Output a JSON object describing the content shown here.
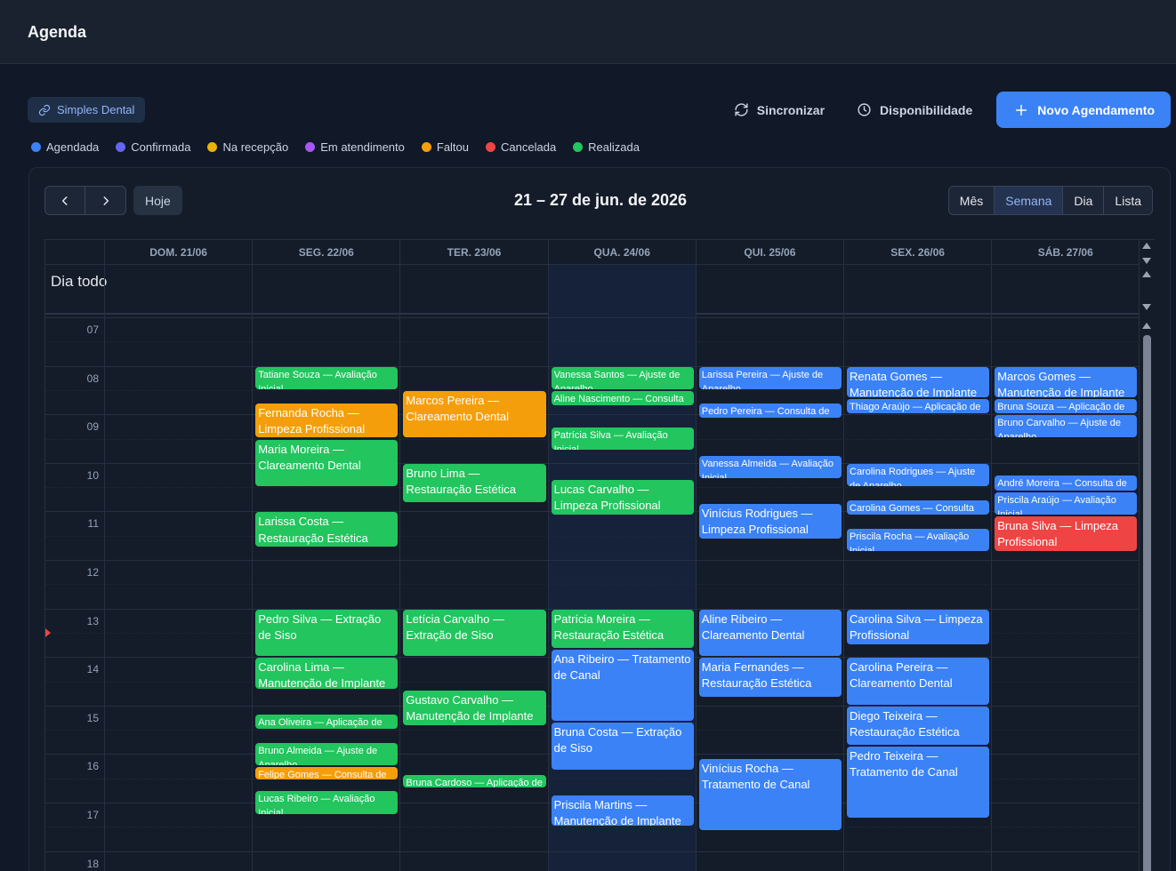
{
  "header": {
    "title": "Agenda"
  },
  "integration_chip": {
    "label": "Simples Dental",
    "icon": "link-icon"
  },
  "actions": {
    "sync_label": "Sincronizar",
    "availability_label": "Disponibilidade",
    "new_label": "Novo Agendamento"
  },
  "legend": [
    {
      "label": "Agendada",
      "color": "#3b82f6"
    },
    {
      "label": "Confirmada",
      "color": "#6366f1"
    },
    {
      "label": "Na recepção",
      "color": "#eab308"
    },
    {
      "label": "Em atendimento",
      "color": "#a855f7"
    },
    {
      "label": "Faltou",
      "color": "#f59e0b"
    },
    {
      "label": "Cancelada",
      "color": "#ef4444"
    },
    {
      "label": "Realizada",
      "color": "#22c55e"
    }
  ],
  "toolbar": {
    "today_label": "Hoje",
    "range_title": "21 – 27 de jun. de 2026",
    "views": [
      "Mês",
      "Semana",
      "Dia",
      "Lista"
    ],
    "active_view": "Semana"
  },
  "days": [
    "DOM. 21/06",
    "SEG. 22/06",
    "TER. 23/06",
    "QUA. 24/06",
    "QUI. 25/06",
    "SEX. 26/06",
    "SÁB. 27/06"
  ],
  "today_index": 3,
  "allday_label": "Dia todo",
  "hours": [
    "07",
    "08",
    "09",
    "10",
    "11",
    "12",
    "13",
    "14",
    "15",
    "16",
    "17",
    "18"
  ],
  "now_time": "13:30",
  "status_colors": {
    "realizada": "#22c55e",
    "faltou": "#f59e0b",
    "agendada": "#3b82f6",
    "cancelada": "#ef4444"
  },
  "events": [
    {
      "day": 1,
      "start": "08:00",
      "end": "08:30",
      "title": "Tatiane Souza — Avaliação Inicial",
      "status": "realizada",
      "size": "small"
    },
    {
      "day": 1,
      "start": "08:45",
      "end": "09:30",
      "title": "Fernanda Rocha — Limpeza Profissional",
      "status": "faltou",
      "size": "big"
    },
    {
      "day": 1,
      "start": "09:30",
      "end": "10:30",
      "title": "Maria Moreira — Clareamento Dental",
      "status": "realizada",
      "size": "big"
    },
    {
      "day": 1,
      "start": "11:00",
      "end": "11:45",
      "title": "Larissa Costa — Restauração Estética",
      "status": "realizada",
      "size": "big"
    },
    {
      "day": 1,
      "start": "13:00",
      "end": "14:00",
      "title": "Pedro Silva — Extração de Siso",
      "status": "realizada",
      "size": "big"
    },
    {
      "day": 1,
      "start": "14:00",
      "end": "14:40",
      "title": "Carolina Lima — Manutenção de Implante",
      "status": "realizada",
      "size": "big"
    },
    {
      "day": 1,
      "start": "15:10",
      "end": "15:30",
      "title": "Ana Oliveira — Aplicação de Flúor",
      "status": "realizada",
      "size": "small"
    },
    {
      "day": 1,
      "start": "15:45",
      "end": "16:15",
      "title": "Bruno Almeida — Ajuste de Aparelho",
      "status": "realizada",
      "size": "small"
    },
    {
      "day": 1,
      "start": "16:15",
      "end": "16:30",
      "title": "Felipe Gomes — Consulta de Rotina",
      "status": "faltou",
      "size": "small"
    },
    {
      "day": 1,
      "start": "16:45",
      "end": "17:15",
      "title": "Lucas Ribeiro — Avaliação Inicial",
      "status": "realizada",
      "size": "small"
    },
    {
      "day": 2,
      "start": "08:30",
      "end": "09:30",
      "title": "Marcos Pereira — Clareamento Dental",
      "status": "faltou",
      "size": "big"
    },
    {
      "day": 2,
      "start": "10:00",
      "end": "10:50",
      "title": "Bruno Lima — Restauração Estética",
      "status": "realizada",
      "size": "big"
    },
    {
      "day": 2,
      "start": "13:00",
      "end": "14:00",
      "title": "Letícia Carvalho — Extração de Siso",
      "status": "realizada",
      "size": "big"
    },
    {
      "day": 2,
      "start": "14:40",
      "end": "15:25",
      "title": "Gustavo Carvalho — Manutenção de Implante",
      "status": "realizada",
      "size": "big"
    },
    {
      "day": 2,
      "start": "16:25",
      "end": "16:40",
      "title": "Bruna Cardoso — Aplicação de Flúor",
      "status": "realizada",
      "size": "small"
    },
    {
      "day": 3,
      "start": "08:00",
      "end": "08:30",
      "title": "Vanessa Santos — Ajuste de Aparelho",
      "status": "realizada",
      "size": "small"
    },
    {
      "day": 3,
      "start": "08:30",
      "end": "08:50",
      "title": "Aline Nascimento — Consulta de Rotina",
      "status": "realizada",
      "size": "small"
    },
    {
      "day": 3,
      "start": "09:15",
      "end": "09:45",
      "title": "Patrícia Silva — Avaliação Inicial",
      "status": "realizada",
      "size": "small"
    },
    {
      "day": 3,
      "start": "10:20",
      "end": "11:05",
      "title": "Lucas Carvalho — Limpeza Profissional",
      "status": "realizada",
      "size": "big"
    },
    {
      "day": 3,
      "start": "13:00",
      "end": "13:50",
      "title": "Patrícia Moreira — Restauração Estética",
      "status": "realizada",
      "size": "big"
    },
    {
      "day": 3,
      "start": "13:50",
      "end": "15:20",
      "title": "Ana Ribeiro — Tratamento de Canal",
      "status": "agendada",
      "size": "big"
    },
    {
      "day": 3,
      "start": "15:20",
      "end": "16:20",
      "title": "Bruna Costa — Extração de Siso",
      "status": "agendada",
      "size": "big"
    },
    {
      "day": 3,
      "start": "16:50",
      "end": "17:30",
      "title": "Priscila Martins — Manutenção de Implante",
      "status": "agendada",
      "size": "big"
    },
    {
      "day": 4,
      "start": "08:00",
      "end": "08:30",
      "title": "Larissa Pereira — Ajuste de Aparelho",
      "status": "agendada",
      "size": "small"
    },
    {
      "day": 4,
      "start": "08:45",
      "end": "09:05",
      "title": "Pedro Pereira — Consulta de Rotina",
      "status": "agendada",
      "size": "small"
    },
    {
      "day": 4,
      "start": "09:50",
      "end": "10:20",
      "title": "Vanessa Almeida — Avaliação Inicial",
      "status": "agendada",
      "size": "small"
    },
    {
      "day": 4,
      "start": "10:50",
      "end": "11:35",
      "title": "Vinícius Rodrigues — Limpeza Profissional",
      "status": "agendada",
      "size": "big"
    },
    {
      "day": 4,
      "start": "13:00",
      "end": "14:00",
      "title": "Aline Ribeiro — Clareamento Dental",
      "status": "agendada",
      "size": "big"
    },
    {
      "day": 4,
      "start": "14:00",
      "end": "14:50",
      "title": "Maria Fernandes — Restauração Estética",
      "status": "agendada",
      "size": "big"
    },
    {
      "day": 4,
      "start": "16:05",
      "end": "17:35",
      "title": "Vinícius Rocha — Tratamento de Canal",
      "status": "agendada",
      "size": "big"
    },
    {
      "day": 5,
      "start": "08:00",
      "end": "08:40",
      "title": "Renata Gomes — Manutenção de Implante",
      "status": "agendada",
      "size": "big"
    },
    {
      "day": 5,
      "start": "08:40",
      "end": "09:00",
      "title": "Thiago Araújo — Aplicação de Flúor",
      "status": "agendada",
      "size": "small"
    },
    {
      "day": 5,
      "start": "10:00",
      "end": "10:30",
      "title": "Carolina Rodrigues — Ajuste de Aparelho",
      "status": "agendada",
      "size": "small"
    },
    {
      "day": 5,
      "start": "10:45",
      "end": "11:05",
      "title": "Carolina Gomes — Consulta de Rotina",
      "status": "agendada",
      "size": "small"
    },
    {
      "day": 5,
      "start": "11:20",
      "end": "11:50",
      "title": "Priscila Rocha — Avaliação Inicial",
      "status": "agendada",
      "size": "small"
    },
    {
      "day": 5,
      "start": "13:00",
      "end": "13:45",
      "title": "Carolina Silva — Limpeza Profissional",
      "status": "agendada",
      "size": "big"
    },
    {
      "day": 5,
      "start": "14:00",
      "end": "15:00",
      "title": "Carolina Pereira — Clareamento Dental",
      "status": "agendada",
      "size": "big"
    },
    {
      "day": 5,
      "start": "15:00",
      "end": "15:50",
      "title": "Diego Teixeira — Restauração Estética",
      "status": "agendada",
      "size": "big"
    },
    {
      "day": 5,
      "start": "15:50",
      "end": "17:20",
      "title": "Pedro Teixeira — Tratamento de Canal",
      "status": "agendada",
      "size": "big"
    },
    {
      "day": 6,
      "start": "08:00",
      "end": "08:40",
      "title": "Marcos Gomes — Manutenção de Implante",
      "status": "agendada",
      "size": "big"
    },
    {
      "day": 6,
      "start": "08:40",
      "end": "09:00",
      "title": "Bruna Souza — Aplicação de Flúor",
      "status": "agendada",
      "size": "small"
    },
    {
      "day": 6,
      "start": "09:00",
      "end": "09:30",
      "title": "Bruno Carvalho — Ajuste de Aparelho",
      "status": "agendada",
      "size": "small"
    },
    {
      "day": 6,
      "start": "10:15",
      "end": "10:35",
      "title": "André Moreira — Consulta de Rotina",
      "status": "agendada",
      "size": "small"
    },
    {
      "day": 6,
      "start": "10:35",
      "end": "11:05",
      "title": "Priscila Araújo — Avaliação Inicial",
      "status": "agendada",
      "size": "small"
    },
    {
      "day": 6,
      "start": "11:05",
      "end": "11:50",
      "title": "Bruna Silva — Limpeza Profissional",
      "status": "cancelada",
      "size": "big"
    }
  ]
}
